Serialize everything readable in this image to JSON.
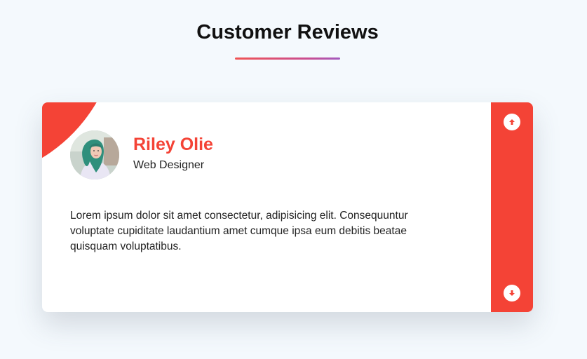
{
  "header": {
    "title": "Customer Reviews"
  },
  "review": {
    "name": "Riley Olie",
    "role": "Web Designer",
    "text": "Lorem ipsum dolor sit amet consectetur, adipisicing elit. Consequuntur voluptate cupiditate laudantium amet cumque ipsa eum debitis beatae quisquam voluptatibus."
  },
  "controls": {
    "up_icon": "arrow-up-icon",
    "down_icon": "arrow-down-icon"
  },
  "colors": {
    "accent": "#f44336",
    "background": "#f4f9fd",
    "card": "#ffffff",
    "underline_start": "#f05454",
    "underline_end": "#a25bbf"
  }
}
